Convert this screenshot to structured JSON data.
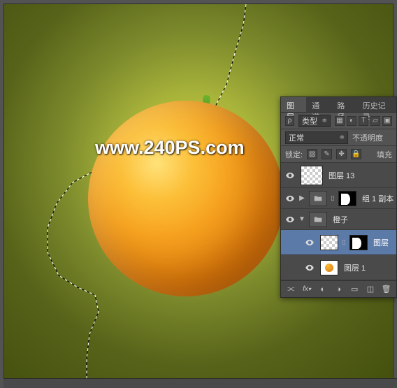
{
  "watermark": "www.240PS.com",
  "panel": {
    "tabs": [
      "图层",
      "通道",
      "路径",
      "历史记录"
    ],
    "active_tab": 0,
    "filter": {
      "kind_label": "类型",
      "blend_mode": "正常"
    },
    "opacity_label": "不透明度",
    "lock_label": "锁定:",
    "fill_label": "填充",
    "layers": [
      {
        "name": "图层 13",
        "type": "raster",
        "thumb": "checker"
      },
      {
        "name": "组 1 副本",
        "type": "group",
        "mask": true,
        "open": false
      },
      {
        "name": "橙子",
        "type": "group",
        "open": true
      },
      {
        "name": "图层",
        "type": "raster",
        "mask": true,
        "selected": true,
        "indent": 2,
        "thumb": "checker"
      },
      {
        "name": "图层 1",
        "type": "raster",
        "indent": 2,
        "thumb": "orange"
      }
    ],
    "footer_icons": [
      "link",
      "fx",
      "mask",
      "adjust",
      "group",
      "new",
      "trash"
    ]
  },
  "icons": {
    "chevron_right": "▶",
    "chevron_down": "▼",
    "divider": "⋮",
    "lock": "🔒",
    "link": "⫘"
  }
}
